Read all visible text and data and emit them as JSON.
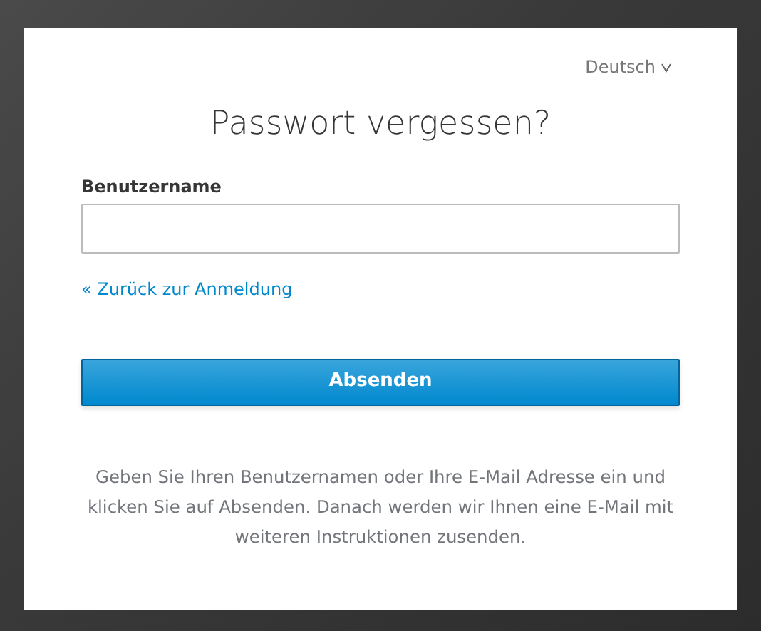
{
  "language": {
    "label": "Deutsch"
  },
  "title": "Passwort vergessen?",
  "username": {
    "label": "Benutzername"
  },
  "back_link": "« Zurück zur Anmeldung",
  "submit_button": "Absenden",
  "info": "Geben Sie Ihren Benutzernamen oder Ihre E-Mail Adresse ein und klicken Sie auf Absenden. Danach werden wir Ihnen eine E-Mail mit weiteren Instruktionen zusenden."
}
